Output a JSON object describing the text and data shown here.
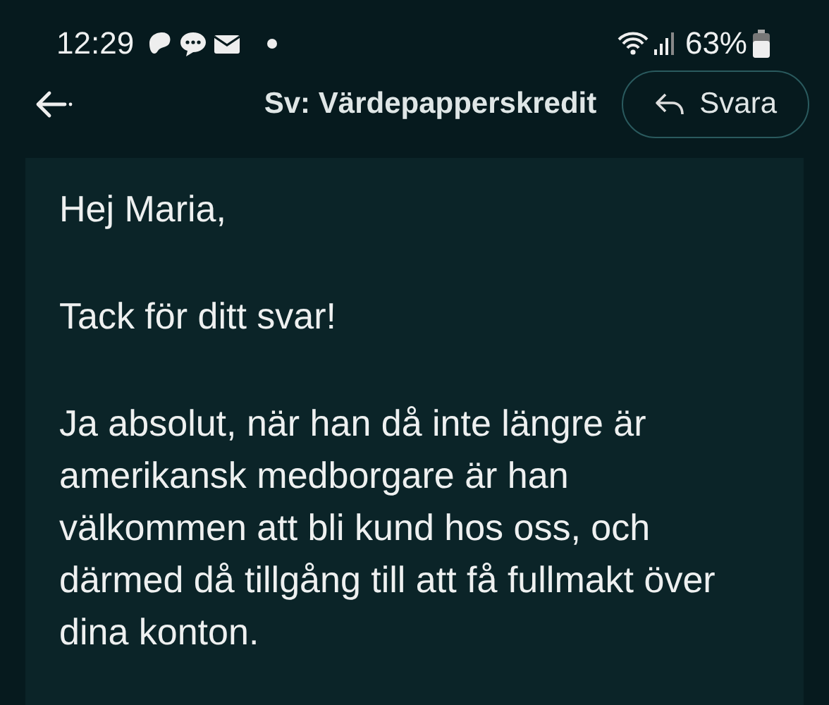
{
  "status_bar": {
    "time": "12:29",
    "battery": "63%"
  },
  "header": {
    "title": "Sv: Värdepapperskredit",
    "reply_button": "Svara"
  },
  "message": {
    "paragraphs": [
      "Hej Maria,",
      "Tack för ditt svar!",
      "Ja absolut, när han då inte längre är amerikansk medborgare är han välkommen att bli kund hos oss, och därmed då tillgång till att få fullmakt över dina konton."
    ]
  }
}
